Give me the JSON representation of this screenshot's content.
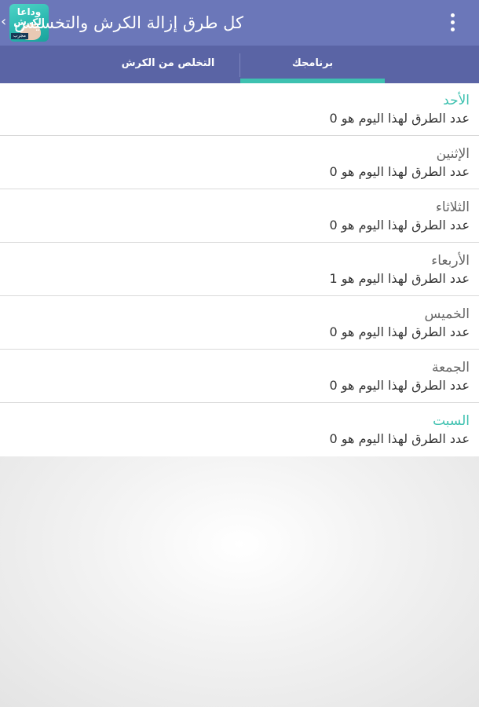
{
  "app_bar": {
    "title": "كل طرق إزالة الكرش والتخسيس",
    "logo": {
      "line1": "وداعا",
      "line2": "الكرش",
      "tag": "مجرب"
    },
    "back_glyph": "‹",
    "menu_icon": "overflow-menu-icon"
  },
  "tabs": [
    {
      "label": "برنامجك",
      "selected": true
    },
    {
      "label": "التخلص من الكرش",
      "selected": false
    }
  ],
  "colors": {
    "app_bar": "#6b77b9",
    "tab_bar": "#5a64a5",
    "accent": "#3ec1b0",
    "day_text": "#666666",
    "count_text": "#333333"
  },
  "days": [
    {
      "name": "الأحد",
      "count_text": "عدد الطرق لهذا اليوم هو 0",
      "highlight": true
    },
    {
      "name": "الإثنين",
      "count_text": "عدد الطرق لهذا اليوم هو 0",
      "highlight": false
    },
    {
      "name": "الثلاثاء",
      "count_text": "عدد الطرق لهذا اليوم هو 0",
      "highlight": false
    },
    {
      "name": "الأربعاء",
      "count_text": "عدد الطرق لهذا اليوم هو 1",
      "highlight": false
    },
    {
      "name": "الخميس",
      "count_text": "عدد الطرق لهذا اليوم هو 0",
      "highlight": false
    },
    {
      "name": "الجمعة",
      "count_text": "عدد الطرق لهذا اليوم هو 0",
      "highlight": false
    },
    {
      "name": "السبت",
      "count_text": "عدد الطرق لهذا اليوم هو 0",
      "highlight": true
    }
  ]
}
